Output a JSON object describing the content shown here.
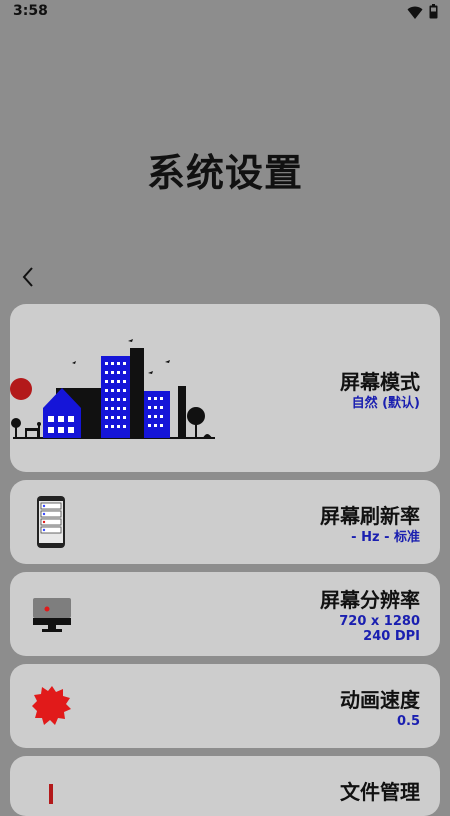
{
  "status_bar": {
    "time": "3:58",
    "icons": [
      "wifi-icon",
      "battery-icon"
    ]
  },
  "page": {
    "title": "系统设置"
  },
  "cards": [
    {
      "title": "屏幕模式",
      "value": "自然 (默认)",
      "icon": "city-illustration"
    },
    {
      "title": "屏幕刷新率",
      "value": "- Hz - 标准",
      "icon": "phone-icon"
    },
    {
      "title": "屏幕分辨率",
      "value": "720 x 1280",
      "value2": "240 DPI",
      "icon": "monitor-icon"
    },
    {
      "title": "动画速度",
      "value": "0.5",
      "icon": "gear-icon"
    },
    {
      "title": "文件管理",
      "icon": "file-icon"
    }
  ],
  "colors": {
    "background": "#8d8d8d",
    "card": "#cdcdcd",
    "accent_blue": "#1a1fb0",
    "accent_red": "#e11a1a"
  }
}
